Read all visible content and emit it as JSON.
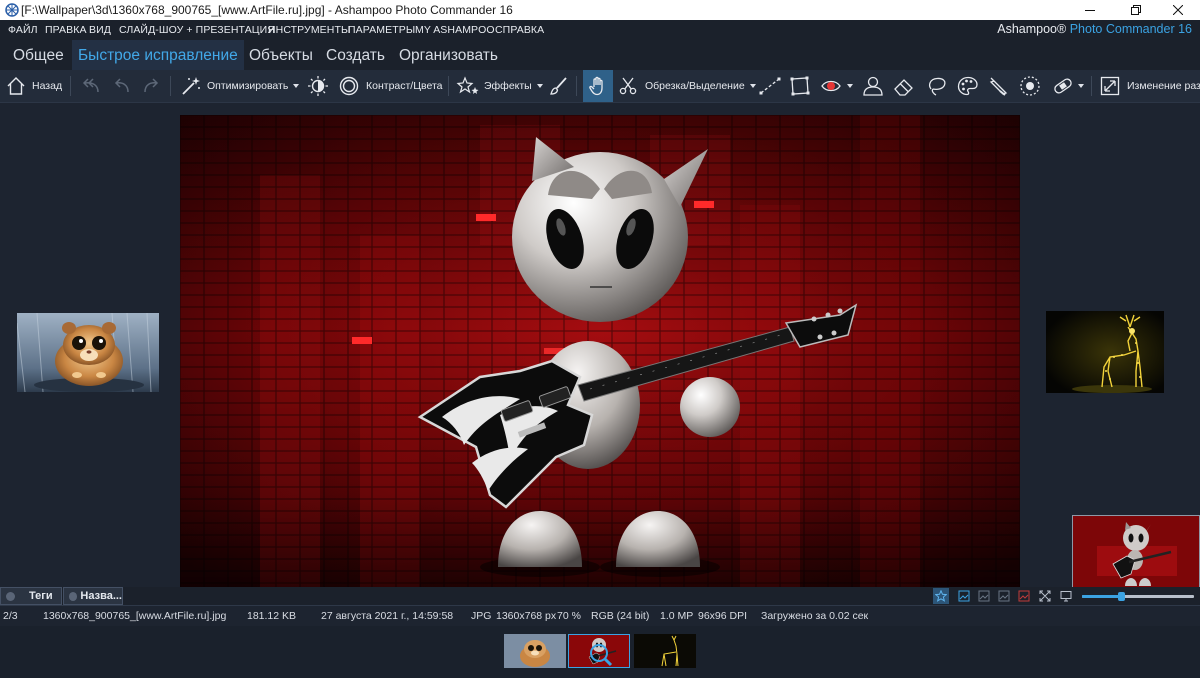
{
  "window": {
    "title": "[F:\\Wallpaper\\3d\\1360x768_900765_[www.ArtFile.ru].jpg] - Ashampoo Photo Commander 16"
  },
  "menu": {
    "items": [
      "ФАЙЛ",
      "ПРАВКА",
      "ВИД",
      "СЛАЙД-ШОУ + ПРЕЗЕНТАЦИЯ",
      "ИНСТРУМЕНТЫ",
      "ПАРАМЕТРЫ",
      "MY ASHAMPOO",
      "СПРАВКА"
    ],
    "brand_prefix": "Ashampoo® ",
    "brand_product": "Photo Commander 16"
  },
  "tabs": [
    "Общее",
    "Быстрое исправление",
    "Объекты",
    "Создать",
    "Организовать"
  ],
  "toolbar": {
    "back": "Назад",
    "optimize": "Оптимизировать",
    "contrast": "Контраст/Цвета",
    "effects": "Эффекты",
    "crop": "Обрезка/Выделение",
    "resize": "Изменение размера"
  },
  "panel_tabs": [
    "Теги",
    "Назва..."
  ],
  "status": {
    "index": "2/3",
    "filename": "1360x768_900765_[www.ArtFile.ru].jpg",
    "filesize": "181.12 KB",
    "date": "27 августа 2021 г., 14:59:58",
    "format": "JPG",
    "dimensions": "1360x768 px",
    "zoom": "70 %",
    "color_mode": "RGB (24 bit)",
    "megapixels": "1.0 MP",
    "dpi": "96x96 DPI",
    "load_time": "Загружено за 0.02 сек"
  },
  "zoom_slider": {
    "value": 0.35
  },
  "colors": {
    "accent": "#3ba3e3",
    "background": "#1d2430",
    "toolbar": "#232c3a",
    "active_tab": "#233044"
  },
  "icons": [
    "app-icon",
    "minimize-icon",
    "restore-icon",
    "close-icon",
    "home-icon",
    "undo-all-icon",
    "undo-icon",
    "redo-icon",
    "magic-wand-icon",
    "brightness-icon",
    "contrast-circle-icon",
    "effects-stars-icon",
    "brush-icon",
    "hand-icon",
    "scissors-icon",
    "line-tool-icon",
    "polygon-tool-icon",
    "red-eye-icon",
    "portrait-icon",
    "eraser-icon",
    "lasso-icon",
    "palette-icon",
    "pipette-icon",
    "vignette-icon",
    "bandage-icon",
    "resize-icon"
  ]
}
